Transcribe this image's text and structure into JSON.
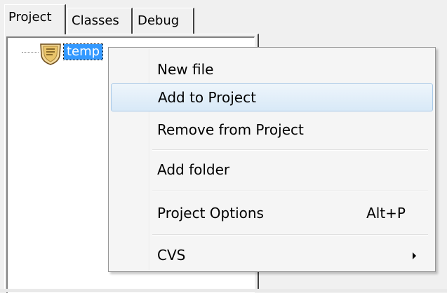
{
  "tabs": [
    {
      "label": "Project",
      "active": true
    },
    {
      "label": "Classes",
      "active": false
    },
    {
      "label": "Debug",
      "active": false
    }
  ],
  "tree": {
    "root_label": "temp",
    "root_icon": "project-icon"
  },
  "context_menu": {
    "items": [
      {
        "label": "New file",
        "shortcut": "",
        "submenu": false,
        "highlighted": false
      },
      {
        "label": "Add to Project",
        "shortcut": "",
        "submenu": false,
        "highlighted": true
      },
      {
        "label": "Remove from Project",
        "shortcut": "",
        "submenu": false,
        "highlighted": false
      },
      {
        "label": "Add folder",
        "shortcut": "",
        "submenu": false,
        "highlighted": false
      },
      {
        "label": "Project Options",
        "shortcut": "Alt+P",
        "submenu": false,
        "highlighted": false
      },
      {
        "label": "CVS",
        "shortcut": "",
        "submenu": true,
        "highlighted": false
      }
    ]
  },
  "colors": {
    "selection": "#3399ff",
    "menu_hover": "#d8e9f7",
    "menu_hover_border": "#a8c9e8"
  }
}
